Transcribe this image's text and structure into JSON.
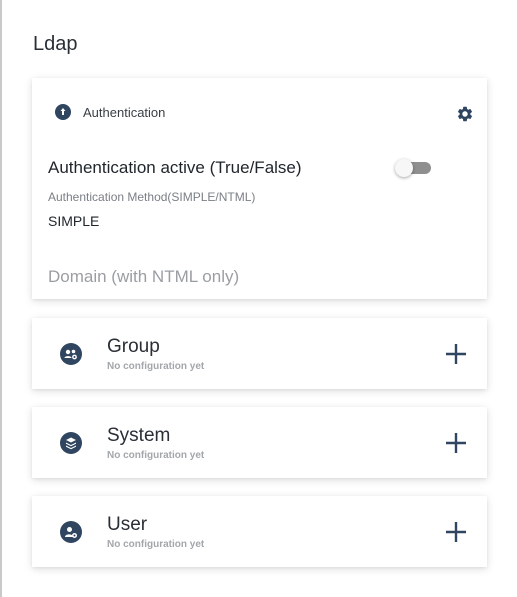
{
  "page": {
    "title": "Ldap"
  },
  "auth": {
    "header_label": "Authentication",
    "active_label": "Authentication active (True/False)",
    "active": false,
    "method_label": "Authentication Method(SIMPLE/NTML)",
    "method_value": "SIMPLE",
    "domain_placeholder": "Domain (with NTML only)"
  },
  "sections": {
    "group": {
      "title": "Group",
      "subtitle": "No configuration yet"
    },
    "system": {
      "title": "System",
      "subtitle": "No configuration yet"
    },
    "user": {
      "title": "User",
      "subtitle": "No configuration yet"
    }
  },
  "colors": {
    "icon": "#2f4560",
    "toggle_track": "#8f8f8f",
    "border": "#c9c9c9"
  }
}
